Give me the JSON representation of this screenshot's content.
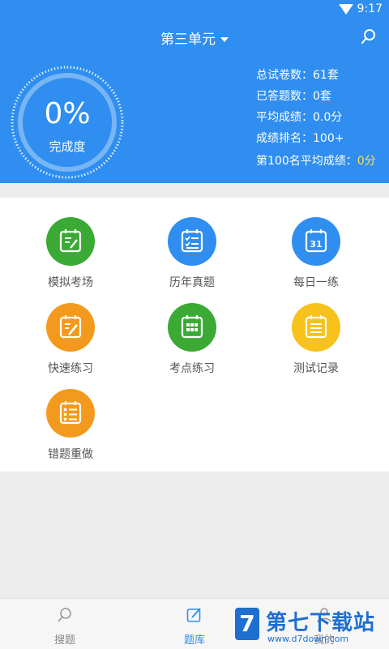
{
  "status_bar": {
    "time": "9:17"
  },
  "header": {
    "title": "第三单元"
  },
  "progress": {
    "percent_text": "0%",
    "label": "完成度",
    "value": 0
  },
  "stats": [
    {
      "text": "总试卷数：61套"
    },
    {
      "text": "已答题数：0套"
    },
    {
      "text": "平均成绩：0.0分"
    },
    {
      "text": "成绩排名：100+"
    }
  ],
  "stat_last": {
    "label": "第100名平均成绩：",
    "value": "0分"
  },
  "menu": [
    {
      "label": "模拟考场",
      "color": "#3aaa35",
      "icon": "exam-icon"
    },
    {
      "label": "历年真题",
      "color": "#2f8ef0",
      "icon": "checklist-icon"
    },
    {
      "label": "每日一练",
      "color": "#2f8ef0",
      "icon": "calendar-31-icon"
    },
    {
      "label": "快速练习",
      "color": "#f39a1e",
      "icon": "edit-calendar-icon"
    },
    {
      "label": "考点练习",
      "color": "#3aaa35",
      "icon": "grid-calendar-icon"
    },
    {
      "label": "测试记录",
      "color": "#f7c21b",
      "icon": "record-icon"
    },
    {
      "label": "错题重做",
      "color": "#f39a1e",
      "icon": "wrong-list-icon"
    }
  ],
  "tabs": [
    {
      "label": "搜题",
      "icon": "search-icon"
    },
    {
      "label": "题库",
      "icon": "edit-icon"
    },
    {
      "label": "我的",
      "icon": "person-icon"
    }
  ],
  "watermark": {
    "logo": "7",
    "title": "第七下载站",
    "url": "www.d7down.com"
  }
}
